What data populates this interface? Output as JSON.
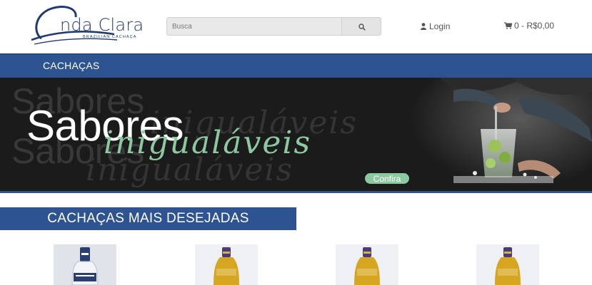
{
  "header": {
    "logo": {
      "name": "nda Clara",
      "tagline": "BRAZILIAN CACHAÇA"
    },
    "search": {
      "placeholder": "Busca",
      "value": "",
      "icon": "search-icon"
    },
    "login": {
      "label": "Login",
      "icon": "user-icon"
    },
    "cart": {
      "label": "0 - R$0,00",
      "icon": "cart-icon"
    }
  },
  "nav": {
    "items": [
      {
        "label": "CACHAÇAS"
      }
    ]
  },
  "banner": {
    "headline": "Sabores",
    "headline_script": "inigualáveis",
    "cta_label": "Confira"
  },
  "section": {
    "title": "CACHAÇAS MAIS DESEJADAS"
  },
  "products": [
    {
      "image": "clear-bottle"
    },
    {
      "image": "gold-bottle"
    },
    {
      "image": "gold-bottle"
    },
    {
      "image": "gold-bottle"
    }
  ],
  "colors": {
    "brand_blue": "#2d5391",
    "logo_navy": "#223a6e",
    "banner_dark": "#1b1b1b",
    "accent_green": "#8cc9a0",
    "text_gray": "#555555"
  }
}
